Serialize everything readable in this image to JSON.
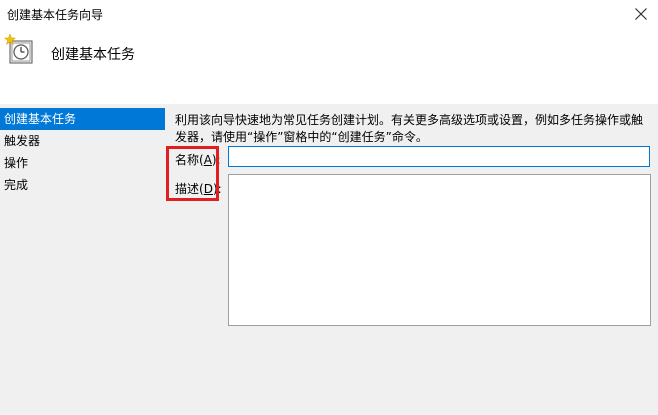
{
  "window": {
    "title": "创建基本任务向导",
    "close_icon": "close-icon"
  },
  "header": {
    "icon": "clock-task-icon",
    "title": "创建基本任务"
  },
  "nav": {
    "items": [
      {
        "label": "创建基本任务",
        "selected": true
      },
      {
        "label": "触发器",
        "selected": false
      },
      {
        "label": "操作",
        "selected": false
      },
      {
        "label": "完成",
        "selected": false
      }
    ]
  },
  "main": {
    "description": "利用该向导快速地为常见任务创建计划。有关更多高级选项或设置，例如多任务操作或触发器，请使用“操作”窗格中的“创建任务”命令。",
    "name_label": {
      "prefix": "名称(",
      "key": "A",
      "suffix": "):"
    },
    "desc_label": {
      "prefix": "描述(",
      "key": "D",
      "suffix": "):"
    },
    "name_value": "",
    "desc_value": ""
  },
  "colors": {
    "selection": "#0078d7",
    "highlight_box": "#e02020",
    "content_bg": "#f0f0f0"
  }
}
